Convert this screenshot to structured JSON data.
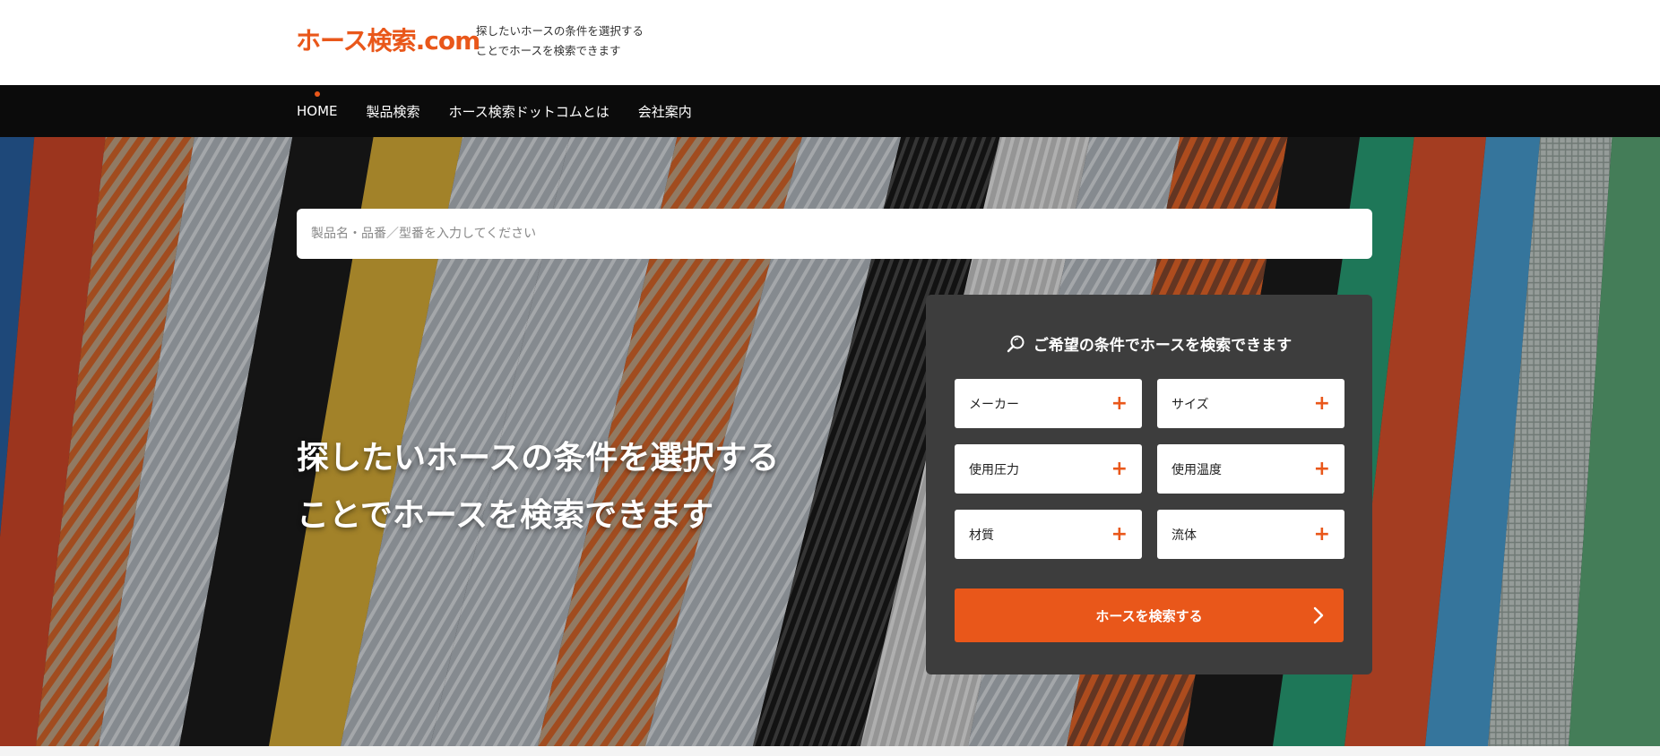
{
  "brand": {
    "logo_text": "ホース検索",
    "logo_suffix": ".com",
    "tagline_line1": "探したいホースの条件を選択する",
    "tagline_line2": "ことでホースを検索できます",
    "accent_color": "#e9571a"
  },
  "nav": {
    "items": [
      {
        "label": "HOME",
        "active": true
      },
      {
        "label": "製品検索"
      },
      {
        "label": "ホース検索ドットコムとは"
      },
      {
        "label": "会社案内"
      }
    ]
  },
  "hero": {
    "search_placeholder": "製品名・品番／型番を入力してください",
    "title_line1": "探したいホースの条件を選択する",
    "title_line2": "ことでホースを検索できます"
  },
  "panel": {
    "title": "ご希望の条件でホースを検索できます",
    "title_icon": "search-icon",
    "conditions": [
      {
        "label": "メーカー"
      },
      {
        "label": "サイズ"
      },
      {
        "label": "使用圧力"
      },
      {
        "label": "使用温度"
      },
      {
        "label": "材質"
      },
      {
        "label": "流体"
      }
    ],
    "plus_symbol": "+",
    "submit_label": "ホースを検索する",
    "submit_icon": "chevron-right-icon"
  }
}
